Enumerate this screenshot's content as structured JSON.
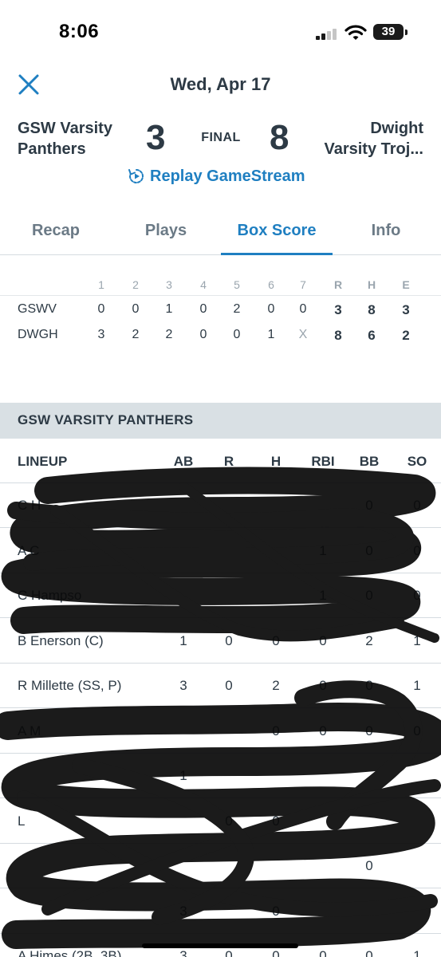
{
  "status_bar": {
    "time": "8:06",
    "battery": "39"
  },
  "header": {
    "date": "Wed, Apr 17"
  },
  "game": {
    "away": {
      "name_line1": "GSW Varsity",
      "name_line2": "Panthers",
      "score": "3"
    },
    "home": {
      "name_line1": "Dwight",
      "name_line2": "Varsity Troj...",
      "score": "8"
    },
    "status": "FINAL",
    "replay_label": "Replay GameStream"
  },
  "tabs": [
    {
      "label": "Recap"
    },
    {
      "label": "Plays"
    },
    {
      "label": "Box Score",
      "active": true
    },
    {
      "label": "Info"
    }
  ],
  "linescore": {
    "headers": [
      "1",
      "2",
      "3",
      "4",
      "5",
      "6",
      "7",
      "R",
      "H",
      "E"
    ],
    "rows": [
      {
        "team": "GSWV",
        "cells": [
          "0",
          "0",
          "1",
          "0",
          "2",
          "0",
          "0",
          "3",
          "8",
          "3"
        ]
      },
      {
        "team": "DWGH",
        "cells": [
          "3",
          "2",
          "2",
          "0",
          "0",
          "1",
          "X",
          "8",
          "6",
          "2"
        ]
      }
    ]
  },
  "section_title": "GSW VARSITY PANTHERS",
  "lineup": {
    "headers": {
      "name": "LINEUP",
      "ab": "AB",
      "r": "R",
      "h": "H",
      "rbi": "RBI",
      "bb": "BB",
      "so": "SO"
    },
    "rows": [
      {
        "name": "C H",
        "ab": "",
        "r": "",
        "h": "",
        "rbi": "",
        "bb": "0",
        "so": "0"
      },
      {
        "name": "A C",
        "ab": "",
        "r": "",
        "h": "",
        "rbi": "1",
        "bb": "0",
        "so": "0"
      },
      {
        "name": "C Hampso",
        "ab": "",
        "r": "",
        "h": "",
        "rbi": "1",
        "bb": "0",
        "so": "0"
      },
      {
        "name": "B Enerson (C)",
        "ab": "1",
        "r": "0",
        "h": "0",
        "rbi": "0",
        "bb": "2",
        "so": "1"
      },
      {
        "name": "R Millette (SS, P)",
        "ab": "3",
        "r": "0",
        "h": "2",
        "rbi": "0",
        "bb": "0",
        "so": "1"
      },
      {
        "name": "A M",
        "ab": "",
        "r": "",
        "h": "0",
        "rbi": "0",
        "bb": "0",
        "so": "0"
      },
      {
        "name": "",
        "ab": "1",
        "r": "",
        "h": "",
        "rbi": "",
        "bb": "",
        "so": ""
      },
      {
        "name": "L",
        "ab": "",
        "r": "0",
        "h": "0",
        "rbi": "",
        "bb": "",
        "so": ""
      },
      {
        "name": "",
        "ab": "",
        "r": "",
        "h": "",
        "rbi": "",
        "bb": "0",
        "so": ""
      },
      {
        "name": "",
        "ab": "3",
        "r": "",
        "h": "0",
        "rbi": "",
        "bb": "",
        "so": ""
      },
      {
        "name": "A Himes (2B, 3B)",
        "ab": "3",
        "r": "0",
        "h": "0",
        "rbi": "0",
        "bb": "0",
        "so": "1"
      }
    ]
  },
  "colors": {
    "accent": "#1f7fc1",
    "text": "#2d3a45",
    "muted": "#9aa5ae",
    "section_bg": "#d9e0e4"
  }
}
